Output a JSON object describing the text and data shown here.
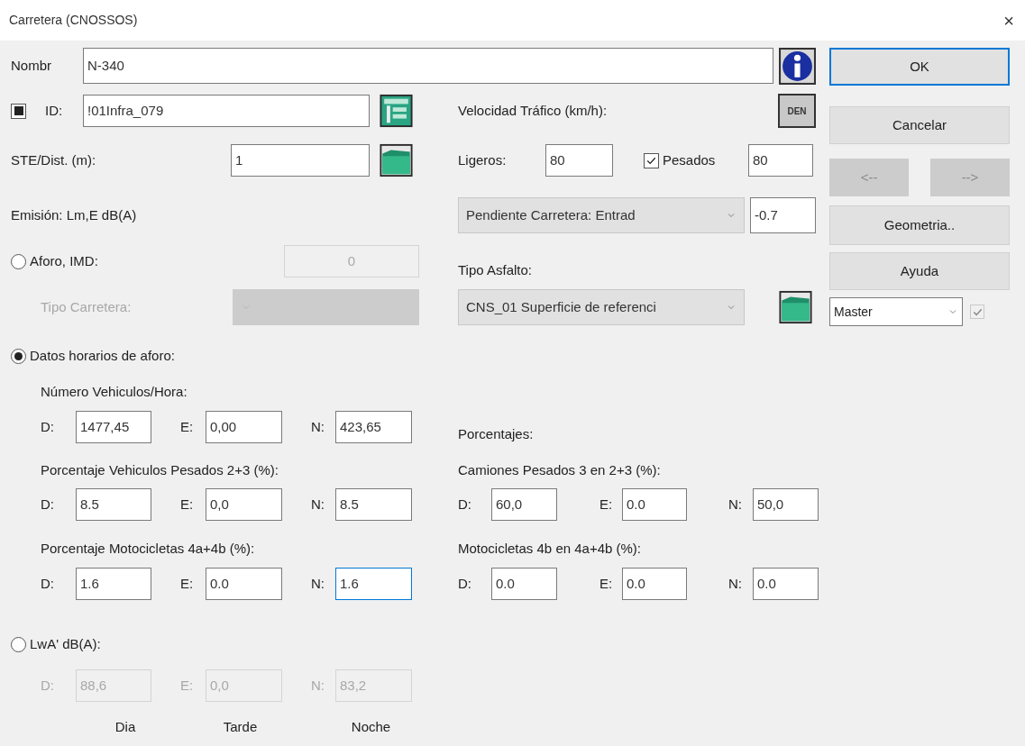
{
  "window": {
    "title": "Carretera (CNOSSOS)",
    "close": "×"
  },
  "nombre": {
    "label": "Nombr",
    "value": "N-340"
  },
  "id": {
    "checked": true,
    "label": "ID:",
    "value": "!01Infra_079"
  },
  "ste": {
    "label": "STE/Dist. (m):",
    "value": "1"
  },
  "emision_label": "Emisión: Lm,E dB(A)",
  "velocidad": {
    "label": "Velocidad Tráfico (km/h):",
    "den_button": "DEN",
    "ligeros_label": "Ligeros:",
    "ligeros": "80",
    "pesados": {
      "label": "Pesados",
      "checked": true,
      "value": "80"
    }
  },
  "pendiente": {
    "dropdown": "Pendiente Carretera: Entrad",
    "value": "-0.7"
  },
  "tipo_asfalto": {
    "label": "Tipo Asfalto:",
    "dropdown": "CNS_01 Superficie de referenci"
  },
  "aforo_imd": {
    "label": "Aforo, IMD:",
    "selected": false,
    "value": "0",
    "tipo_carretera_label": "Tipo Carretera:"
  },
  "datos_horarios": {
    "label": "Datos horarios de aforo:",
    "selected": true,
    "porcentajes_label": "Porcentajes:",
    "left_groups": [
      {
        "label": "Número Vehiculos/Hora:",
        "fields": [
          {
            "prefix": "D:",
            "value": "1477,45",
            "focused": false
          },
          {
            "prefix": "E:",
            "value": "0,00",
            "focused": false
          },
          {
            "prefix": "N:",
            "value": "423,65",
            "focused": false
          }
        ]
      },
      {
        "label": "Porcentaje Vehiculos Pesados 2+3 (%):",
        "fields": [
          {
            "prefix": "D:",
            "value": "8.5",
            "focused": false
          },
          {
            "prefix": "E:",
            "value": "0,0",
            "focused": false
          },
          {
            "prefix": "N:",
            "value": "8.5",
            "focused": false
          }
        ]
      },
      {
        "label": "Porcentaje Motocicletas  4a+4b (%):",
        "fields": [
          {
            "prefix": "D:",
            "value": "1.6",
            "focused": false
          },
          {
            "prefix": "E:",
            "value": "0.0",
            "focused": false
          },
          {
            "prefix": "N:",
            "value": "1.6",
            "focused": true
          }
        ]
      }
    ],
    "right_groups": [
      {
        "label": "Camiones Pesados 3 en 2+3 (%):",
        "fields": [
          {
            "prefix": "D:",
            "value": "60,0",
            "focused": false
          },
          {
            "prefix": "E:",
            "value": "0.0",
            "focused": false
          },
          {
            "prefix": "N:",
            "value": "50,0",
            "focused": false
          }
        ]
      },
      {
        "label": "Motocicletas 4b en 4a+4b (%):",
        "fields": [
          {
            "prefix": "D:",
            "value": "0.0",
            "focused": false
          },
          {
            "prefix": "E:",
            "value": "0.0",
            "focused": false
          },
          {
            "prefix": "N:",
            "value": "0.0",
            "focused": false
          }
        ]
      }
    ]
  },
  "lwa": {
    "label": "LwA' dB(A):",
    "selected": false,
    "fields": [
      {
        "prefix": "D:",
        "value": "88,6"
      },
      {
        "prefix": "E:",
        "value": "0,0"
      },
      {
        "prefix": "N:",
        "value": "83,2"
      }
    ],
    "periods": [
      "Dia",
      "Tarde",
      "Noche"
    ]
  },
  "buttons": [
    {
      "label": "OK",
      "default": true
    },
    {
      "label": "Cancelar",
      "default": false
    }
  ],
  "nav_buttons": [
    {
      "label": "<--",
      "disabled": true
    },
    {
      "label": "-->",
      "disabled": true
    }
  ],
  "more_buttons": [
    {
      "label": "Geometria..",
      "default": false
    },
    {
      "label": "Ayuda",
      "default": false
    }
  ],
  "master": {
    "value": "Master",
    "checked": true,
    "disabled": true
  }
}
